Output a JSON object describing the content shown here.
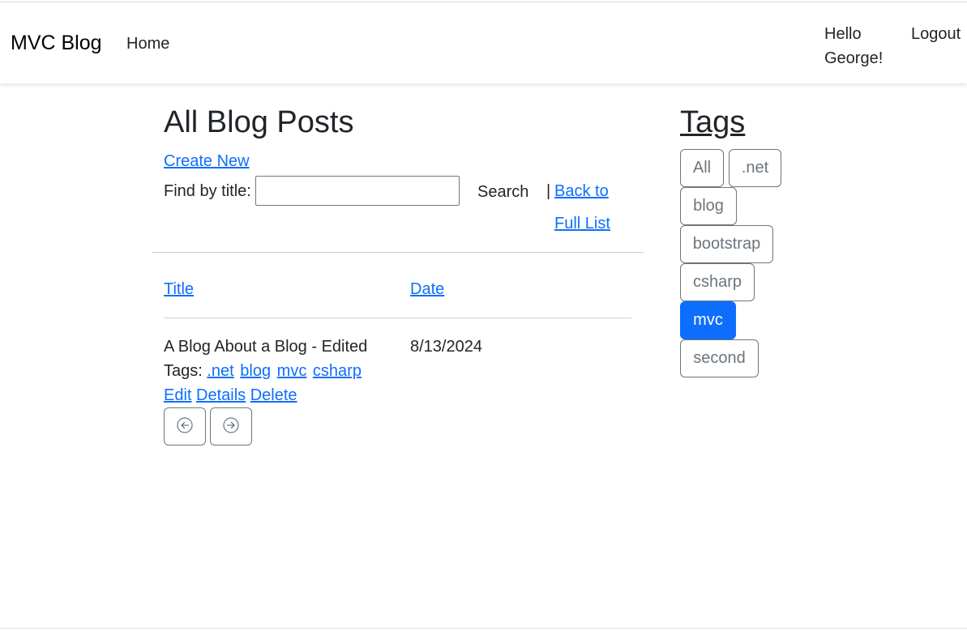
{
  "nav": {
    "brand": "MVC Blog",
    "home": "Home",
    "greeting": "Hello George!",
    "logout": "Logout"
  },
  "main": {
    "title": "All Blog Posts",
    "create_new": "Create New",
    "find_label": "Find by title:",
    "search_value": "",
    "search_button": "Search",
    "separator": "|",
    "back_link": "Back to Full List",
    "columns": {
      "title": "Title",
      "date": "Date"
    },
    "posts": [
      {
        "title": "A Blog About a Blog - Edited",
        "date": "8/13/2024",
        "tags_label": "Tags:",
        "tags": [
          ".net",
          "blog",
          "mvc",
          "csharp"
        ],
        "actions": [
          "Edit",
          "Details",
          "Delete"
        ]
      }
    ],
    "pagination": {
      "prev_icon": "arrow-left-circle-icon",
      "next_icon": "arrow-right-circle-icon"
    }
  },
  "sidebar": {
    "title": "Tags",
    "tags": [
      "All",
      ".net",
      "blog",
      "bootstrap",
      "csharp",
      "mvc",
      "second"
    ],
    "active_tag": "mvc"
  },
  "colors": {
    "link": "#0d6efd",
    "active_tag_bg": "#0d6efd",
    "tag_border": "#6c757d",
    "text": "#212529"
  }
}
